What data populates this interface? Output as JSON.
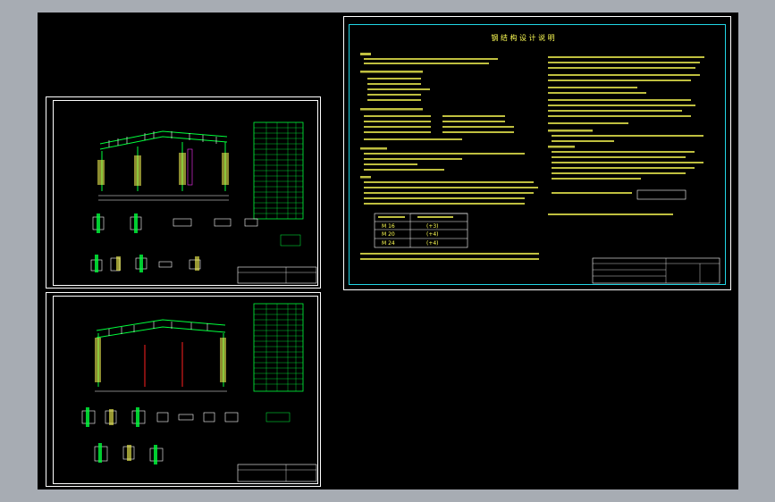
{
  "viewer": {
    "background_color": "#a7acb3",
    "canvas_color": "#000000"
  },
  "sheets": [
    {
      "id": "sheet-a",
      "content": "frame-elevation-with-details-and-steel-table"
    },
    {
      "id": "sheet-b",
      "content": "frame-elevation-with-details-and-steel-table"
    },
    {
      "id": "sheet-c",
      "content": "design-notes-sheet",
      "title": "钢 结 构 设 计 说 明",
      "table_rows": [
        {
          "grade": "M 16",
          "value": "(+3)"
        },
        {
          "grade": "M 20",
          "value": "(+4)"
        },
        {
          "grade": "M 24",
          "value": "(+4)"
        }
      ]
    }
  ],
  "colors": {
    "structure_lines": "#ffffff",
    "frame_members": "#00ff3c",
    "text_yellow": "#ffff55",
    "accent_magenta": "#ff33ff",
    "accent_red": "#ff2020",
    "border_cyan": "#21d6e6"
  }
}
